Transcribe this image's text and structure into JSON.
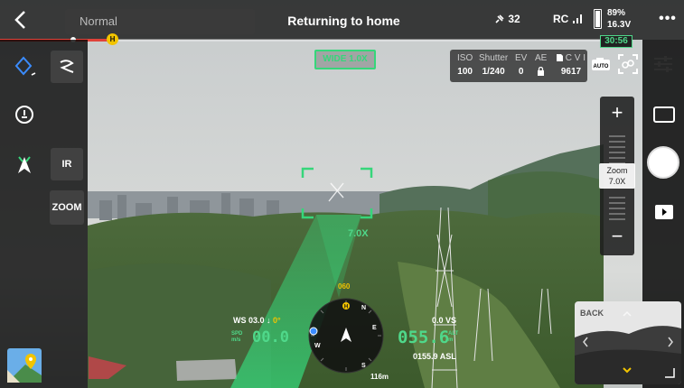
{
  "colors": {
    "accent_green": "#36d67a",
    "warning_yellow": "#f2c400",
    "progress_red": "#e0433a",
    "panel_dark": "#1e1e1e"
  },
  "topbar": {
    "back_icon": "chevron-left-icon",
    "flight_mode": "Normal",
    "status": "Returning to home",
    "satellites": "32",
    "satellite_icon": "satellite-icon",
    "rc_label": "RC",
    "rc_signal_icon": "signal-bars-icon",
    "battery_percent": "89%",
    "battery_voltage": "16.3V",
    "battery_level": 0.89,
    "flight_time": "30:56",
    "more_icon": "ellipsis-icon",
    "more_label": "•••"
  },
  "rth_progress": {
    "fraction": 0.19,
    "home_marker": "H"
  },
  "camera": {
    "lens_label": "WIDE 1.0X",
    "exposure": {
      "iso_label": "ISO",
      "iso_value": "100",
      "shutter_label": "Shutter",
      "shutter_value": "1/240",
      "ev_label": "EV",
      "ev_value": "0",
      "ae_label": "AE",
      "ae_icon": "lock-icon",
      "storage_label": "C V I",
      "storage_value": "9617"
    },
    "auto_icon": "auto-mode-icon",
    "track_icon": "target-tracking-icon",
    "settings_icon": "sliders-icon"
  },
  "leftbar": {
    "waypoint_icon": "waypoint-diamond-icon",
    "flight_route_icon": "route-swirl-icon",
    "home_point_icon": "home-point-icon",
    "beacon_icon": "beacon-icon",
    "ir_label": "IR",
    "zoom_label": "ZOOM",
    "map_icon": "map-icon"
  },
  "zoom": {
    "plus_label": "+",
    "minus_label": "−",
    "readout_label": "Zoom",
    "readout_value": "7.0X",
    "overlay_value": "7.0X"
  },
  "rightbar": {
    "mode_switch_icon": "photo-mode-icon",
    "shutter_icon": "shutter-icon",
    "playback_icon": "play-icon"
  },
  "hud": {
    "wind": "WS 03.0 ↓",
    "wind_angle": "0°",
    "speed_unit_line1": "SPD",
    "speed_unit_line2": "m/s",
    "speed": "00.0",
    "vertical_speed": "0.0 VS",
    "altitude": "055.6",
    "alt_unit_line1": "ALT",
    "alt_unit_line2": "m",
    "asl": "0155.9 ASL",
    "heading": "060",
    "home_distance": "116m",
    "compass_icon": "aircraft-arrow-icon",
    "compass_marks": [
      "N",
      "E",
      "S",
      "W"
    ]
  },
  "pip": {
    "label": "BACK"
  }
}
